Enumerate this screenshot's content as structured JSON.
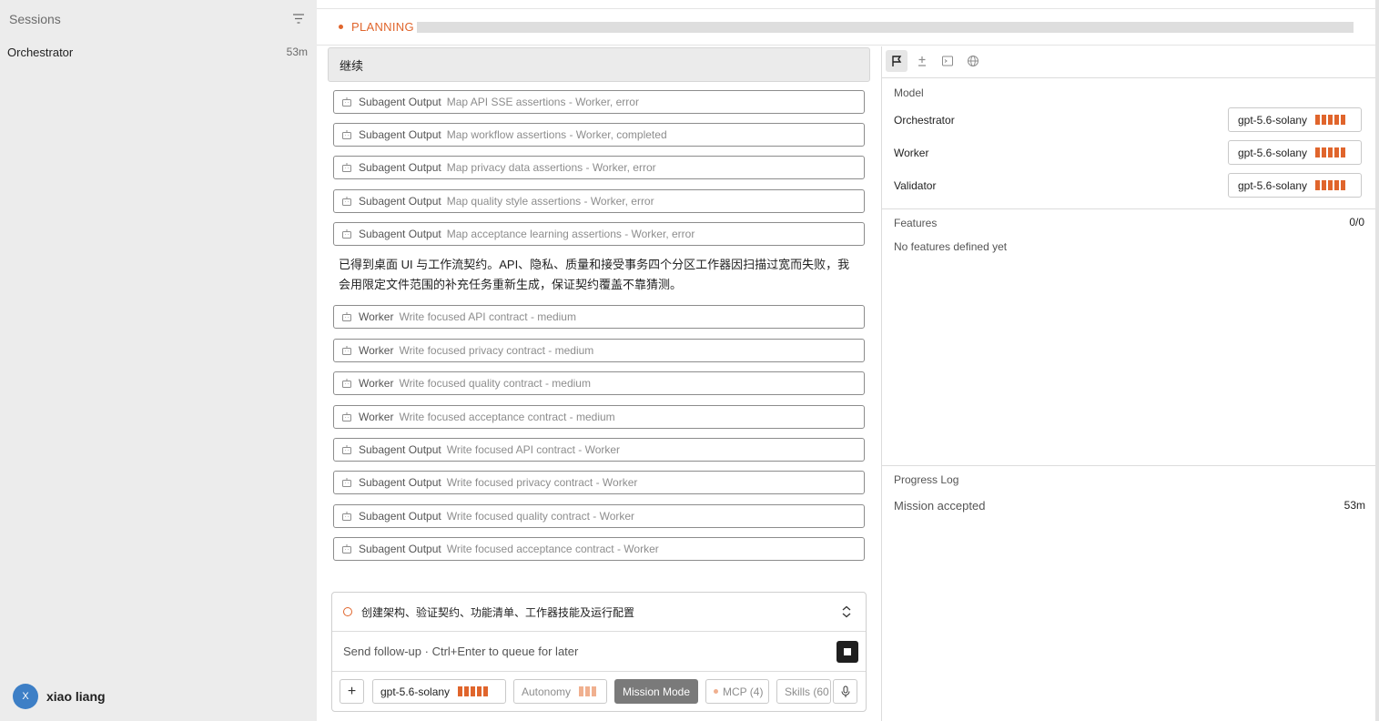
{
  "sidebar": {
    "title": "Sessions",
    "items": [
      {
        "name": "Orchestrator",
        "time": "53m"
      }
    ],
    "user": {
      "initial": "X",
      "name": "xiao liang"
    }
  },
  "status": {
    "label": "PLANNING",
    "color": "#e0652c"
  },
  "chat": {
    "user_message": "继续",
    "tasks_a": [
      {
        "kind": "Subagent Output",
        "desc": "Map API SSE assertions - Worker, error"
      },
      {
        "kind": "Subagent Output",
        "desc": "Map workflow assertions - Worker, completed"
      },
      {
        "kind": "Subagent Output",
        "desc": "Map privacy data assertions - Worker, error"
      },
      {
        "kind": "Subagent Output",
        "desc": "Map quality style assertions - Worker, error"
      },
      {
        "kind": "Subagent Output",
        "desc": "Map acceptance learning assertions - Worker, error"
      }
    ],
    "assistant_message": "已得到桌面 UI 与工作流契约。API、隐私、质量和接受事务四个分区工作器因扫描过宽而失败，我会用限定文件范围的补充任务重新生成，保证契约覆盖不靠猜测。",
    "tasks_b": [
      {
        "kind": "Worker",
        "desc": "Write focused API contract - medium"
      },
      {
        "kind": "Worker",
        "desc": "Write focused privacy contract - medium"
      },
      {
        "kind": "Worker",
        "desc": "Write focused quality contract - medium"
      },
      {
        "kind": "Worker",
        "desc": "Write focused acceptance contract - medium"
      },
      {
        "kind": "Subagent Output",
        "desc": "Write focused API contract - Worker"
      },
      {
        "kind": "Subagent Output",
        "desc": "Write focused privacy contract - Worker"
      },
      {
        "kind": "Subagent Output",
        "desc": "Write focused quality contract - Worker"
      },
      {
        "kind": "Subagent Output",
        "desc": "Write focused acceptance contract - Worker"
      }
    ]
  },
  "composer": {
    "plan_text": "创建架构、验证契约、功能清单、工作器技能及运行配置",
    "placeholder": "Send follow-up",
    "hint": "Ctrl+Enter to queue for later",
    "toolbar": {
      "plus": "+",
      "model": "gpt-5.6-solany",
      "autonomy": "Autonomy",
      "mission": "Mission Mode",
      "mcp": "MCP (4)",
      "skills": "Skills (60"
    }
  },
  "panel": {
    "model_section": "Model",
    "models": [
      {
        "role": "Orchestrator",
        "model": "gpt-5.6-solany"
      },
      {
        "role": "Worker",
        "model": "gpt-5.6-solany"
      },
      {
        "role": "Validator",
        "model": "gpt-5.6-solany"
      }
    ],
    "features_section": "Features",
    "features_count": "0/0",
    "features_empty": "No features defined yet",
    "log_section": "Progress Log",
    "log": [
      {
        "text": "Mission accepted",
        "time": "53m"
      }
    ]
  },
  "colors": {
    "accent": "#e0652c",
    "accent_light": "#f0b08f",
    "avatar": "#3d7fc6"
  }
}
